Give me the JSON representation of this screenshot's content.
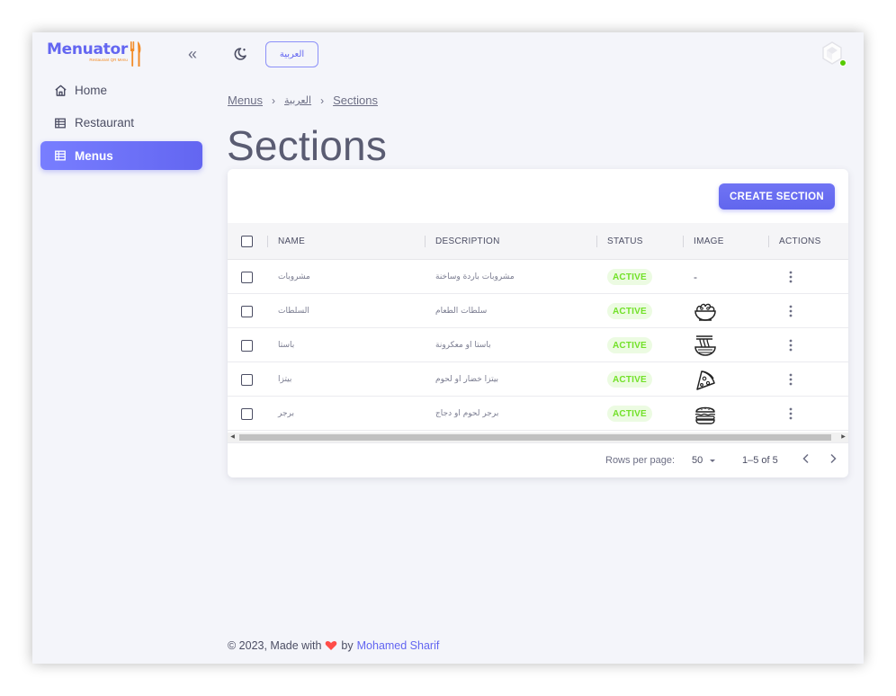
{
  "brand": {
    "name": "Menuator",
    "tagline": "Restaurant QR Menu",
    "color": "#6366f1",
    "accent": "#f28c28"
  },
  "sidebar": {
    "items": [
      {
        "label": "Home",
        "icon": "home-icon",
        "active": false
      },
      {
        "label": "Restaurant",
        "icon": "table-icon",
        "active": false
      },
      {
        "label": "Menus",
        "icon": "table-icon",
        "active": true
      }
    ]
  },
  "topbar": {
    "language_button": "العربية",
    "status": "online"
  },
  "breadcrumb": {
    "item1": "Menus",
    "item2": "العربية",
    "item3": "Sections"
  },
  "page": {
    "title": "Sections"
  },
  "toolbar": {
    "create_label": "CREATE SECTION"
  },
  "table": {
    "columns": {
      "name": "NAME",
      "description": "DESCRIPTION",
      "status": "STATUS",
      "image": "IMAGE",
      "actions": "ACTIONS"
    },
    "rows": [
      {
        "name": "مشروبات",
        "description": "مشروبات باردة وساخنة",
        "status": "ACTIVE",
        "image": "-",
        "image_icon": ""
      },
      {
        "name": "السلطات",
        "description": "سلطات الطعام",
        "status": "ACTIVE",
        "image": "",
        "image_icon": "salad-icon"
      },
      {
        "name": "باستا",
        "description": "باستا او معكرونة",
        "status": "ACTIVE",
        "image": "",
        "image_icon": "noodles-icon"
      },
      {
        "name": "بيتزا",
        "description": "بيتزا خضار او لحوم",
        "status": "ACTIVE",
        "image": "",
        "image_icon": "pizza-icon"
      },
      {
        "name": "برجر",
        "description": "برجر لحوم او دجاج",
        "status": "ACTIVE",
        "image": "",
        "image_icon": "burger-icon"
      }
    ]
  },
  "pagination": {
    "rows_label": "Rows per page:",
    "rows_value": "50",
    "range": "1–5 of 5"
  },
  "footer": {
    "text": "© 2023, Made with",
    "by": "by",
    "author": "Mohamed Sharif",
    "heart_color": "#ff4d49"
  },
  "colors": {
    "status_active_bg": "#ecfbe2",
    "status_active_text": "#72e128",
    "primary": "#6366f1"
  }
}
